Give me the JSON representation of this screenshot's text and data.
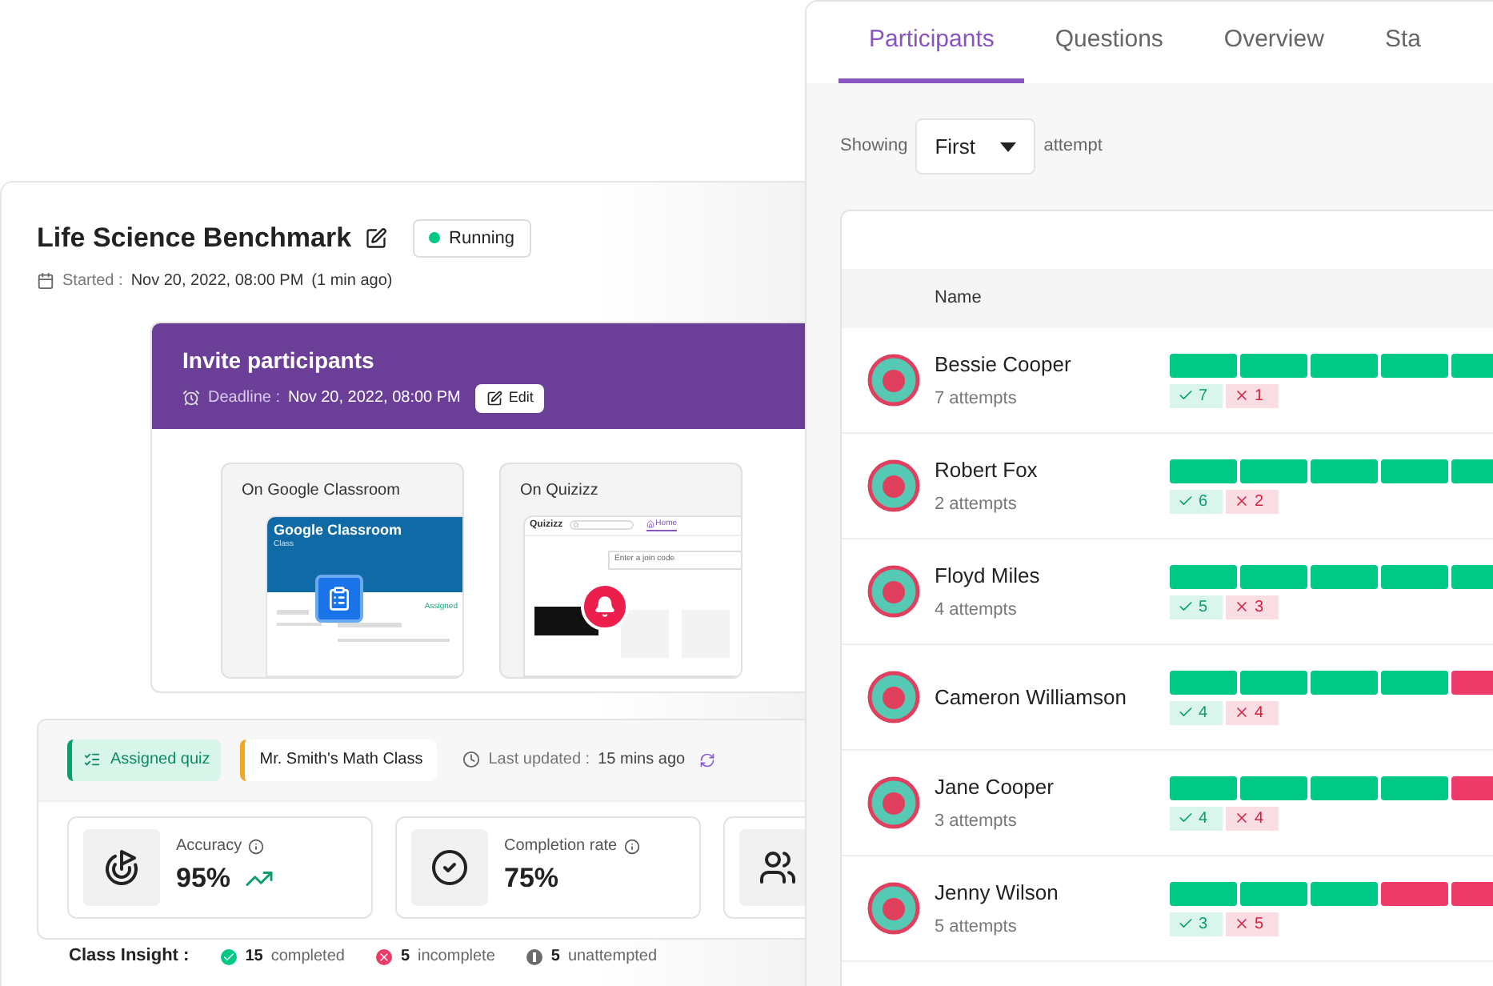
{
  "quiz": {
    "title": "Life Science Benchmark",
    "status": "Running",
    "started_label": "Started :",
    "started_at": "Nov 20, 2022, 08:00 PM",
    "started_ago": "(1 min ago)"
  },
  "invite": {
    "title": "Invite participants",
    "deadline_label": "Deadline :",
    "deadline": "Nov 20, 2022, 08:00 PM",
    "edit_button": "Edit",
    "options": [
      {
        "kind": "google",
        "label": "On Google Classroom",
        "preview_title": "Google Classroom",
        "preview_subtitle": "Class",
        "preview_status": "Assigned"
      },
      {
        "kind": "quizizz",
        "label": "On Quizizz",
        "preview_logo": "Quizizz",
        "preview_tab": "Home",
        "preview_placeholder": "Enter a join code"
      }
    ]
  },
  "report": {
    "tags": [
      {
        "kind": "assigned",
        "label": "Assigned quiz"
      },
      {
        "kind": "class",
        "label": "Mr. Smith's Math Class"
      }
    ],
    "updated_label": "Last updated :",
    "updated_value": "15 mins ago",
    "metrics": [
      {
        "kind": "accuracy",
        "label": "Accuracy",
        "value": "95%"
      },
      {
        "kind": "completion",
        "label": "Completion rate",
        "value": "75%"
      },
      {
        "kind": "participants"
      }
    ],
    "insight_label": "Class Insight :",
    "insights": [
      {
        "kind": "completed",
        "count": "15",
        "label": "completed",
        "color": "#00c985"
      },
      {
        "kind": "incomplete",
        "count": "5",
        "label": "incomplete",
        "color": "#ec3b68"
      },
      {
        "kind": "unattempted",
        "count": "5",
        "label": "unattempted",
        "color": "#6b6b6b"
      }
    ]
  },
  "tabs": [
    {
      "label": "Participants",
      "selected": true
    },
    {
      "label": "Questions",
      "selected": false
    },
    {
      "label": "Overview",
      "selected": false
    },
    {
      "label": "Sta",
      "selected": false
    }
  ],
  "filter": {
    "prefix": "Showing",
    "value": "First",
    "suffix": "attempt"
  },
  "table": {
    "columns": [
      "Name"
    ],
    "rows": [
      {
        "name": "Bessie Cooper",
        "attempts": "7 attempts",
        "correct": "7",
        "incorrect": "1",
        "segments": [
          {
            "correct": true
          },
          {
            "correct": true
          },
          {
            "correct": true
          },
          {
            "correct": true
          },
          {
            "correct": true
          }
        ]
      },
      {
        "name": "Robert Fox",
        "attempts": "2 attempts",
        "correct": "6",
        "incorrect": "2",
        "segments": [
          {
            "correct": true
          },
          {
            "correct": true
          },
          {
            "correct": true
          },
          {
            "correct": true
          },
          {
            "correct": true
          }
        ]
      },
      {
        "name": "Floyd Miles",
        "attempts": "4 attempts",
        "correct": "5",
        "incorrect": "3",
        "segments": [
          {
            "correct": true
          },
          {
            "correct": true
          },
          {
            "correct": true
          },
          {
            "correct": true
          },
          {
            "correct": true
          }
        ]
      },
      {
        "name": "Cameron Williamson",
        "correct": "4",
        "incorrect": "4",
        "segments": [
          {
            "correct": true
          },
          {
            "correct": true
          },
          {
            "correct": true
          },
          {
            "correct": true
          },
          {
            "correct": false
          }
        ]
      },
      {
        "name": "Jane Cooper",
        "attempts": "3 attempts",
        "correct": "4",
        "incorrect": "4",
        "segments": [
          {
            "correct": true
          },
          {
            "correct": true
          },
          {
            "correct": true
          },
          {
            "correct": true
          },
          {
            "correct": false
          }
        ]
      },
      {
        "name": "Jenny Wilson",
        "attempts": "5 attempts",
        "correct": "3",
        "incorrect": "5",
        "segments": [
          {
            "correct": true
          },
          {
            "correct": true
          },
          {
            "correct": true
          },
          {
            "correct": false
          },
          {
            "correct": false
          }
        ]
      }
    ]
  }
}
